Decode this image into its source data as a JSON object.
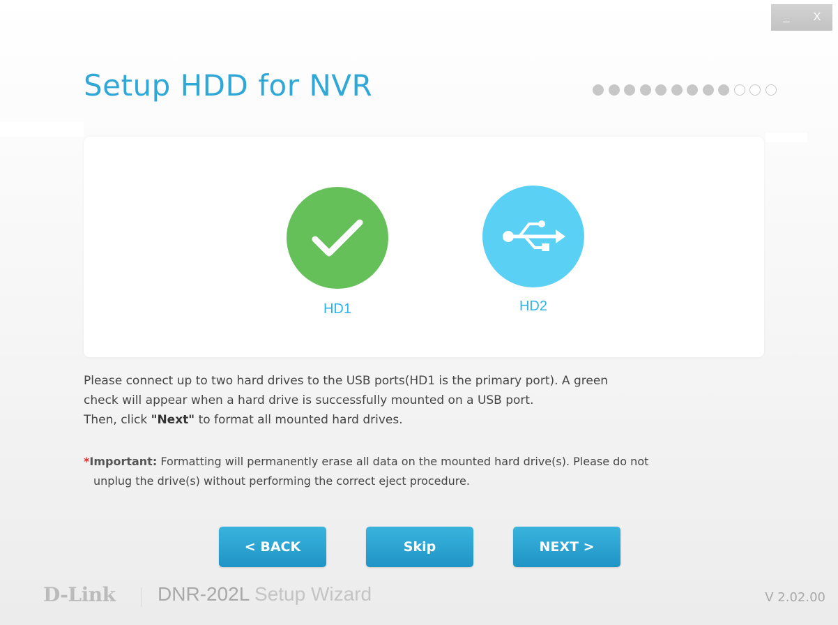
{
  "window": {
    "minimize_label": "_",
    "close_label": "X"
  },
  "header": {
    "title": "Setup HDD for NVR",
    "progress": {
      "total_steps": 12,
      "completed_steps": 9
    }
  },
  "drives": [
    {
      "label": "HD1",
      "status": "mounted",
      "icon": "check-icon",
      "color": "#66c05a"
    },
    {
      "label": "HD2",
      "status": "not-connected",
      "icon": "usb-icon",
      "color": "#5ad0f5"
    }
  ],
  "instructions": {
    "line1": "Please connect up to two hard drives to the USB ports(HD1 is the primary port). A green",
    "line2": "check will appear when a hard drive is successfully  mounted on a USB port.",
    "line3_prefix": "Then, click ",
    "line3_bold": "\"Next\"",
    "line3_suffix": "  to format all mounted hard drives."
  },
  "important": {
    "star": "*",
    "label": "Important:",
    "text1": "Formatting will permanently erase all data on the mounted hard drive(s). Please do not",
    "text2": "unplug the drive(s) without performing the correct eject procedure."
  },
  "buttons": {
    "back": "<  BACK",
    "skip": "Skip",
    "next": "NEXT  >"
  },
  "footer": {
    "brand": "D-Link",
    "product": "DNR-202L",
    "product_suffix": "Setup Wizard",
    "version": "V 2.02.00"
  },
  "colors": {
    "accent": "#2fa7d7",
    "button": "#2a9fd0",
    "success": "#66c05a",
    "usb": "#5ad0f5",
    "important_star": "#d9302c"
  }
}
